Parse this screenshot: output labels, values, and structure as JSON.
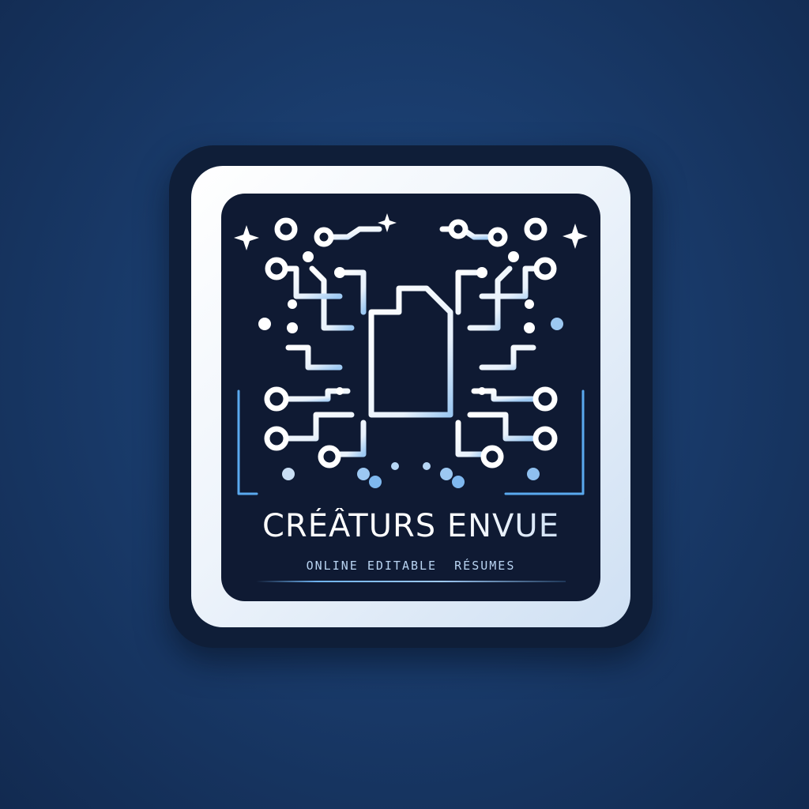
{
  "logo": {
    "title": "CRÉÂTURS ENVUE",
    "tagline": "ONLINE EDITABLE  RÉSUMES",
    "icon": "circuit-document-icon"
  },
  "colors": {
    "background": "#1a3d6e",
    "frame": "#ffffff",
    "inner": "#0f1a33",
    "accent": "#6fb4f2",
    "trace": "#ffffff"
  }
}
